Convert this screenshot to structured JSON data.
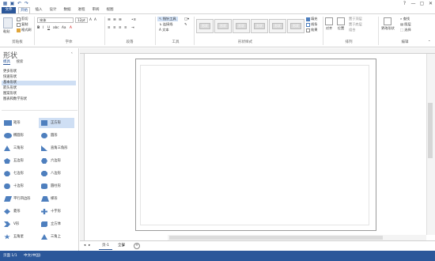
{
  "quick_access": [
    "save-icon",
    "undo-icon",
    "redo-icon"
  ],
  "window_controls": [
    "?",
    "—",
    "▢",
    "✕"
  ],
  "tabs": [
    "文件",
    "开始",
    "插入",
    "设计",
    "数据",
    "进程",
    "审阅",
    "视图"
  ],
  "ribbon": {
    "clipboard": {
      "paste": "粘贴",
      "cut": "剪切",
      "copy": "复制",
      "format_painter": "格式刷",
      "label": "剪贴板"
    },
    "font": {
      "font_name": "宋体",
      "font_size": "12pt",
      "label": "字体"
    },
    "paragraph": {
      "label": "段落"
    },
    "tools": {
      "pointer": "指针工具",
      "connector": "连接线",
      "text": "A 文本",
      "label": "工具"
    },
    "shape_styles": {
      "quick": [
        "形状",
        "形状",
        "形状",
        "形状",
        "形状",
        "形状"
      ],
      "fill": "填充",
      "line": "线条",
      "effects": "效果",
      "label": "形状样式"
    },
    "arrange": {
      "align": "对齐",
      "position": "位置",
      "bring_forward": "置于顶层",
      "send_backward": "置于底层",
      "group": "组合",
      "label": "排列"
    },
    "edit": {
      "find": "查找",
      "layers": "图层",
      "select": "选择",
      "change_shape": "更改形状",
      "label": "编辑"
    }
  },
  "pane": {
    "title": "形状",
    "tabs": [
      "模具",
      "搜索"
    ],
    "stencils": [
      "更多形状",
      "快速形状",
      "基本形状",
      "箭头形状",
      "图案形状",
      "图表和数学形状"
    ],
    "selected_stencil": "基本形状",
    "shapes": [
      [
        "矩形",
        "正方形"
      ],
      [
        "椭圆形",
        "圆形"
      ],
      [
        "三角形",
        "直角三角形"
      ],
      [
        "五边形",
        "六边形"
      ],
      [
        "七边形",
        "八边形"
      ],
      [
        "十边形",
        "圆柱形"
      ],
      [
        "平行四边形",
        "梯形"
      ],
      [
        "菱形",
        "十字形"
      ],
      [
        "V形",
        "立方体"
      ],
      [
        "五角星",
        "三角上"
      ]
    ],
    "selected_shape": "正方形"
  },
  "page_tabs": {
    "page1": "页-1",
    "all": "全部",
    "add": "+"
  },
  "status": {
    "page": "页面 1/1",
    "language": "中文(中国)"
  },
  "colors": {
    "accent": "#2b579a",
    "shape_blue": "#4e7fbe",
    "selection": "#cfdff4"
  }
}
